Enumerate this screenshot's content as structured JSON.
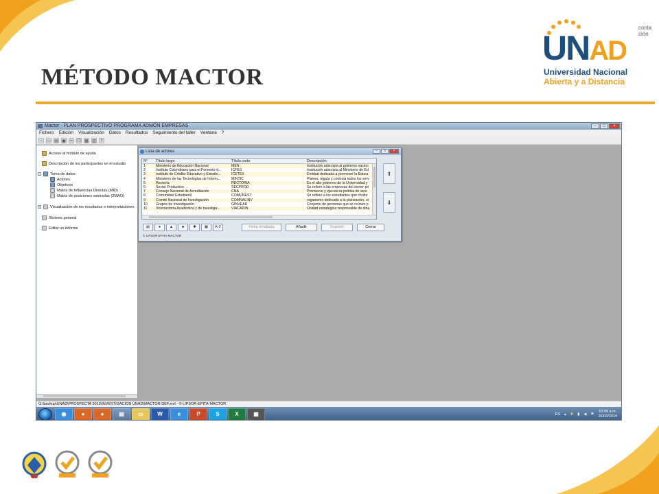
{
  "slide": {
    "title": "MÉTODO MACTOR",
    "corner_text": [
      "conla",
      "ción"
    ]
  },
  "logo": {
    "word": "UNAD",
    "line1": "Universidad Nacional",
    "line2": "Abierta y a Distancia",
    "colors": {
      "blue": "#1c4f7c",
      "orange": "#f0a21e"
    }
  },
  "window": {
    "title": "Mactor  -  PLAN PROSPECTIVO PROGRAMA ADMON EMPRESAS",
    "menu": [
      "Fichero",
      "Edición",
      "Visualización",
      "Datos",
      "Resultados",
      "Seguimiento del taller",
      "Ventana",
      "?"
    ],
    "status": "G:\\backup\\UNAD\\PROSPECTA 2013\\INVESTIGACION UNAD\\MACTOR DEF.xml  -  © LIPSOR-EPITA-MACTOR"
  },
  "tree": [
    {
      "label": "Acceso al módulo de ayuda"
    },
    {
      "label": "Descripción de los participantes en el estudio"
    },
    {
      "label": "Toma de datos"
    },
    {
      "label": "Actores"
    },
    {
      "label": "Objetivos"
    },
    {
      "label": "Matriz de Influencias Directas (MID)"
    },
    {
      "label": "Matriz de posiciones valoradas (2MAO)"
    },
    {
      "label": "Visualización de los resultados e interpretaciones"
    },
    {
      "label": "Síntesis general"
    },
    {
      "label": "Editar un informe"
    }
  ],
  "dialog": {
    "title": "Lista de actores",
    "columns": [
      "N°",
      "Título largo",
      "Título corto",
      "Descripción"
    ],
    "rows": [
      [
        "1",
        "Ministerio de Educación Nacional",
        "MEN",
        "Institución adscripta al gobierno nacion"
      ],
      [
        "2",
        "Instituto Colombiano para el Fomento d...",
        "ICFES",
        "Institución adscripta al Ministerio de Ed"
      ],
      [
        "3",
        "Instituto de Crédito Educativo y Estudio...",
        "ICETEX",
        "Entidad dedicada a promover la Educa"
      ],
      [
        "4",
        "Ministerio de las Tecnologías de Inform...",
        "MINTIC",
        "Planea, regula y controla todos los serv"
      ],
      [
        "5",
        "Rectoría",
        "RECTORIA",
        "Es el alto gobierno de la Universidad y"
      ],
      [
        "6",
        "Sector Productivo",
        "SECPROD",
        "Se refiere a las empresas del sector pri"
      ],
      [
        "7",
        "Consejo Nacional de Acreditación",
        "CNA",
        "Promueve y ejecuta la política de acre"
      ],
      [
        "8",
        "Comunidad Estudiantil",
        "COMUNEST",
        "Se refiere a los estudiantes que confor"
      ],
      [
        "9",
        "Comité Nacional de Investigación",
        "COMNALINV",
        "organismo dedicado a la planeación, or"
      ],
      [
        "10",
        "Grupos de Investigación",
        "GINVEAD",
        "Conjunto de personas que se reúnen p"
      ],
      [
        "11",
        "Vicerrectoria Académica y de Investiga...",
        "VIACADIN",
        "Unidad estratégica responsable de dina"
      ]
    ],
    "buttons": {
      "ficha": "Ficha detallada",
      "anadir": "Añadir",
      "suprimir": "Suprimir",
      "cerrar": "Cerrar",
      "sort": "A-Z"
    },
    "footer": "© LIPSOR-EPITA-MACTOR"
  },
  "taskbar": {
    "lang": "ES",
    "time": "10:08 a.m.",
    "date": "26/03/2014",
    "apps": [
      "chrome-icon",
      "firefox-icon",
      "firefox-icon",
      "explorer-icon",
      "folder-icon",
      "word-icon",
      "ie-icon",
      "powerpoint-icon",
      "skype-icon",
      "excel-icon",
      "calculator-icon"
    ]
  }
}
